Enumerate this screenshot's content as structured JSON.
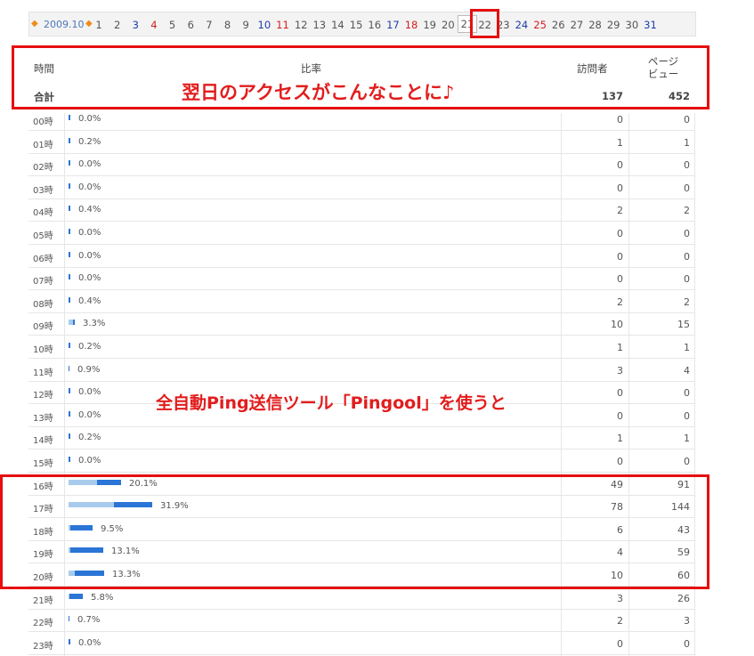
{
  "nav": {
    "prev_arrow": "◆",
    "month": "2009.10",
    "next_arrow": "◆",
    "days": [
      "1",
      "2",
      "3",
      "4",
      "5",
      "6",
      "7",
      "8",
      "9",
      "10",
      "11",
      "12",
      "13",
      "14",
      "15",
      "16",
      "17",
      "18",
      "19",
      "20",
      "21",
      "22",
      "23",
      "24",
      "25",
      "26",
      "27",
      "28",
      "29",
      "30",
      "31"
    ],
    "saturdays": [
      "3",
      "10",
      "17",
      "24",
      "31"
    ],
    "sundays": [
      "4",
      "11",
      "18",
      "25"
    ],
    "selected": "21"
  },
  "table": {
    "col_hour": "時間",
    "col_ratio": "比率",
    "col_visitors": "訪問者",
    "col_pageviews_line1": "ページ",
    "col_pageviews_line2": "ビュー",
    "total_label": "合計",
    "total_visitors": "137",
    "total_pageviews": "452",
    "rows": [
      {
        "hour": "00時",
        "pct": "0.0%",
        "v": "0",
        "pv": "0",
        "lw": 0,
        "dw": 0
      },
      {
        "hour": "01時",
        "pct": "0.2%",
        "v": "1",
        "pv": "1",
        "lw": 0,
        "dw": 0
      },
      {
        "hour": "02時",
        "pct": "0.0%",
        "v": "0",
        "pv": "0",
        "lw": 0,
        "dw": 0
      },
      {
        "hour": "03時",
        "pct": "0.0%",
        "v": "0",
        "pv": "0",
        "lw": 0,
        "dw": 0
      },
      {
        "hour": "04時",
        "pct": "0.4%",
        "v": "2",
        "pv": "2",
        "lw": 0,
        "dw": 0
      },
      {
        "hour": "05時",
        "pct": "0.0%",
        "v": "0",
        "pv": "0",
        "lw": 0,
        "dw": 0
      },
      {
        "hour": "06時",
        "pct": "0.0%",
        "v": "0",
        "pv": "0",
        "lw": 0,
        "dw": 0
      },
      {
        "hour": "07時",
        "pct": "0.0%",
        "v": "0",
        "pv": "0",
        "lw": 0,
        "dw": 0
      },
      {
        "hour": "08時",
        "pct": "0.4%",
        "v": "2",
        "pv": "2",
        "lw": 0,
        "dw": 0
      },
      {
        "hour": "09時",
        "pct": "3.3%",
        "v": "10",
        "pv": "15",
        "lw": 5,
        "dw": 2
      },
      {
        "hour": "10時",
        "pct": "0.2%",
        "v": "1",
        "pv": "1",
        "lw": 0,
        "dw": 0
      },
      {
        "hour": "11時",
        "pct": "0.9%",
        "v": "3",
        "pv": "4",
        "lw": 0,
        "dw": 1
      },
      {
        "hour": "12時",
        "pct": "0.0%",
        "v": "0",
        "pv": "0",
        "lw": 0,
        "dw": 0
      },
      {
        "hour": "13時",
        "pct": "0.0%",
        "v": "0",
        "pv": "0",
        "lw": 0,
        "dw": 0
      },
      {
        "hour": "14時",
        "pct": "0.2%",
        "v": "1",
        "pv": "1",
        "lw": 0,
        "dw": 0
      },
      {
        "hour": "15時",
        "pct": "0.0%",
        "v": "0",
        "pv": "0",
        "lw": 0,
        "dw": 0
      },
      {
        "hour": "16時",
        "pct": "20.1%",
        "v": "49",
        "pv": "91",
        "lw": 32,
        "dw": 27
      },
      {
        "hour": "17時",
        "pct": "31.9%",
        "v": "78",
        "pv": "144",
        "lw": 51,
        "dw": 43
      },
      {
        "hour": "18時",
        "pct": "9.5%",
        "v": "6",
        "pv": "43",
        "lw": 2,
        "dw": 25
      },
      {
        "hour": "19時",
        "pct": "13.1%",
        "v": "4",
        "pv": "59",
        "lw": 2,
        "dw": 37
      },
      {
        "hour": "20時",
        "pct": "13.3%",
        "v": "10",
        "pv": "60",
        "lw": 7,
        "dw": 33
      },
      {
        "hour": "21時",
        "pct": "5.8%",
        "v": "3",
        "pv": "26",
        "lw": 1,
        "dw": 15
      },
      {
        "hour": "22時",
        "pct": "0.7%",
        "v": "2",
        "pv": "3",
        "lw": 0,
        "dw": 1
      },
      {
        "hour": "23時",
        "pct": "0.0%",
        "v": "0",
        "pv": "0",
        "lw": 0,
        "dw": 0
      }
    ]
  },
  "annotations": {
    "top_caption": "翌日のアクセスがこんなことに♪",
    "middle_caption": "全自動Ping送信ツール「Pingool」を使うと"
  },
  "colors": {
    "annotation_red": "#e60f0f",
    "bar_pageview": "#a9cbec",
    "bar_visitor": "#2a75d6",
    "saturday": "#1f3ea8",
    "sunday": "#d41e1e"
  }
}
